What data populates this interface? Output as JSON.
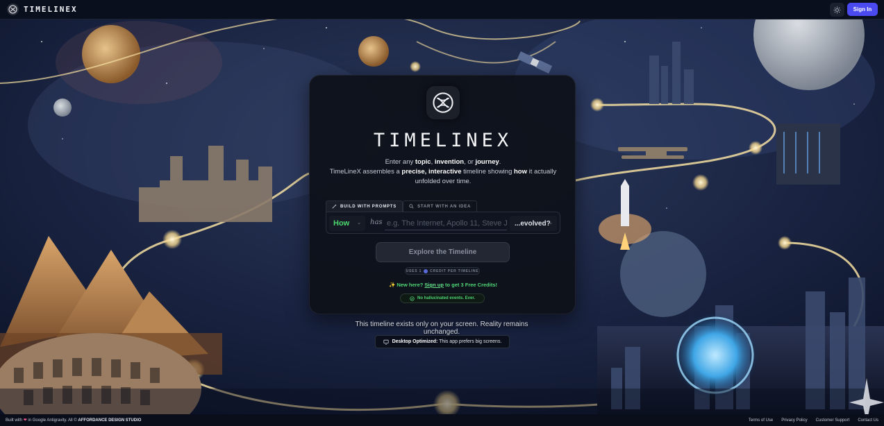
{
  "header": {
    "brand": "TIMELINEX",
    "sign_in_label": "Sign In",
    "icons": {
      "logo": "timelinex-logo-icon",
      "theme": "sun-icon"
    }
  },
  "card": {
    "wordmark": "TIMELINEX",
    "tagline": {
      "line1_pre": "Enter any ",
      "topic": "topic",
      "comma1": ", ",
      "invention": "invention",
      "or": ", or ",
      "journey": "journey",
      "period": ".",
      "line2_pre": "TimeLineX assembles a ",
      "precise": "precise, interactive",
      "line2_mid": " timeline showing ",
      "how": "how",
      "line2_post": " it actually",
      "line3": "unfolded over time."
    },
    "tabs": [
      {
        "label": "BUILD WITH PROMPTS",
        "icon": "wand-icon",
        "active": true
      },
      {
        "label": "START WITH AN IDEA",
        "icon": "search-icon",
        "active": false
      }
    ],
    "prompt": {
      "how_value": "How",
      "has_label": "has",
      "topic_placeholder": "e.g. The Internet, Apollo 11, Steve Jobs",
      "evolved_value": "...evolved?"
    },
    "explore_label": "Explore the Timeline",
    "credit_pre": "USES 1",
    "credit_post": "CREDIT PER TIMELINE",
    "signup": {
      "pre": "✨ New here? ",
      "link": "Sign up",
      "post": " to get 3 Free Credits!"
    },
    "no_hallucination": "No hallucinated events. Ever."
  },
  "disclaimer": "This timeline exists only on your screen. Reality remains unchanged.",
  "desktop": {
    "bold": "Desktop Optimized:",
    "text": " This app prefers big screens."
  },
  "footer": {
    "credit_pre": "Built with ",
    "credit_mid": " in Google Antigravity. All © ",
    "credit_studio": "AFFORDANCE DESIGN STUDIO",
    "links": [
      "Terms of Use",
      "Privacy Policy",
      "Customer Support",
      "Contact Us"
    ]
  },
  "colors": {
    "accent": "#4b49f0",
    "green": "#4fd675",
    "background": "#0b1226"
  }
}
